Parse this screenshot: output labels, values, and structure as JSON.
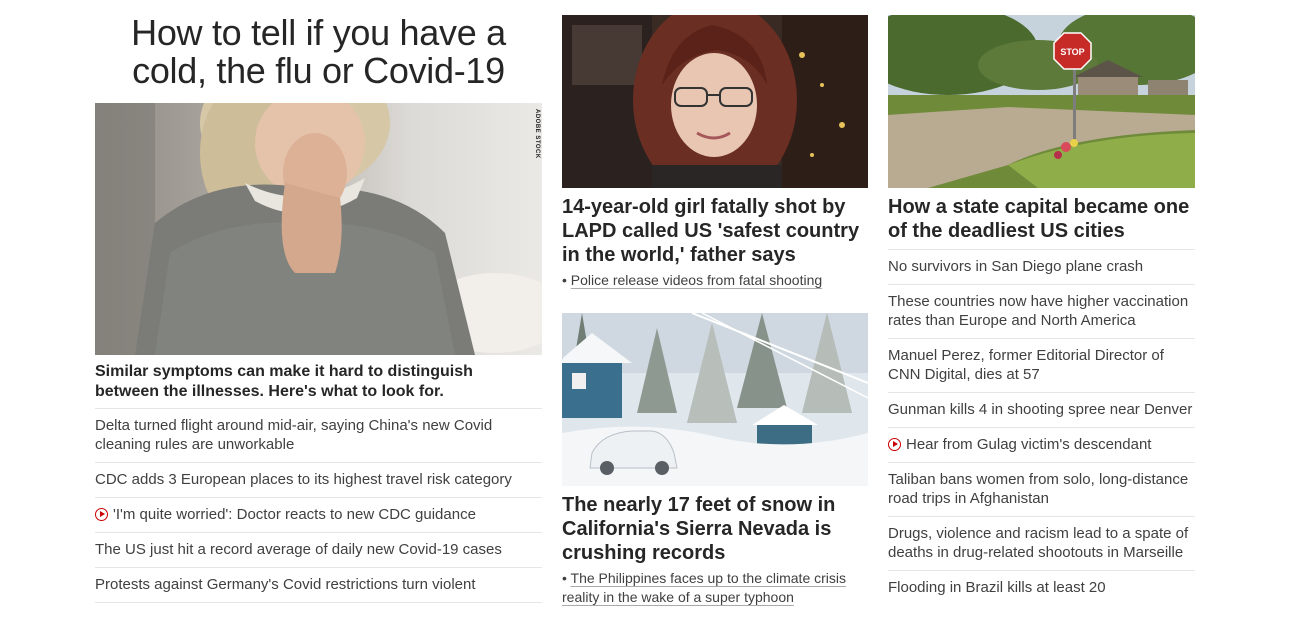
{
  "col1": {
    "headline": "How to tell if you have a cold, the flu or Covid-19",
    "image_credit": "ADOBE STOCK",
    "description": "Similar symptoms can make it hard to distinguish between the illnesses. Here's what to look for.",
    "links": [
      {
        "text": "Delta turned flight around mid-air, saying China's new Covid cleaning rules are unworkable",
        "video": false
      },
      {
        "text": "CDC adds 3 European places to its highest travel risk category",
        "video": false
      },
      {
        "text": "'I'm quite worried': Doctor reacts to new CDC guidance",
        "video": true
      },
      {
        "text": "The US just hit a record average of daily new Covid-19 cases",
        "video": false
      },
      {
        "text": "Protests against Germany's Covid restrictions turn violent",
        "video": false
      }
    ]
  },
  "col2": {
    "story1": {
      "headline": "14-year-old girl fatally shot by LAPD called US 'safest country in the world,' father says",
      "sub_link": "Police release videos from fatal shooting"
    },
    "story2": {
      "headline": "The nearly 17 feet of snow in California's Sierra Nevada is crushing records",
      "sub_link": "The Philippines faces up to the climate crisis reality in the wake of a super typhoon"
    }
  },
  "col3": {
    "headline": "How a state capital became one of the deadliest US cities",
    "stop_sign": "STOP",
    "links": [
      {
        "text": "No survivors in San Diego plane crash",
        "video": false
      },
      {
        "text": "These countries now have higher vaccination rates than Europe and North America",
        "video": false
      },
      {
        "text": "Manuel Perez, former Editorial Director of CNN Digital, dies at 57",
        "video": false
      },
      {
        "text": "Gunman kills 4 in shooting spree near Denver",
        "video": false
      },
      {
        "text": "Hear from Gulag victim's descendant",
        "video": true
      },
      {
        "text": "Taliban bans women from solo, long-distance road trips in Afghanistan",
        "video": false
      },
      {
        "text": "Drugs, violence and racism lead to a spate of deaths in drug-related shootouts in Marseille",
        "video": false
      },
      {
        "text": "Flooding in Brazil kills at least 20",
        "video": false
      }
    ]
  },
  "colors": {
    "video_accent": "#cc0000",
    "text": "#262626",
    "divider": "#e6e6e6"
  }
}
